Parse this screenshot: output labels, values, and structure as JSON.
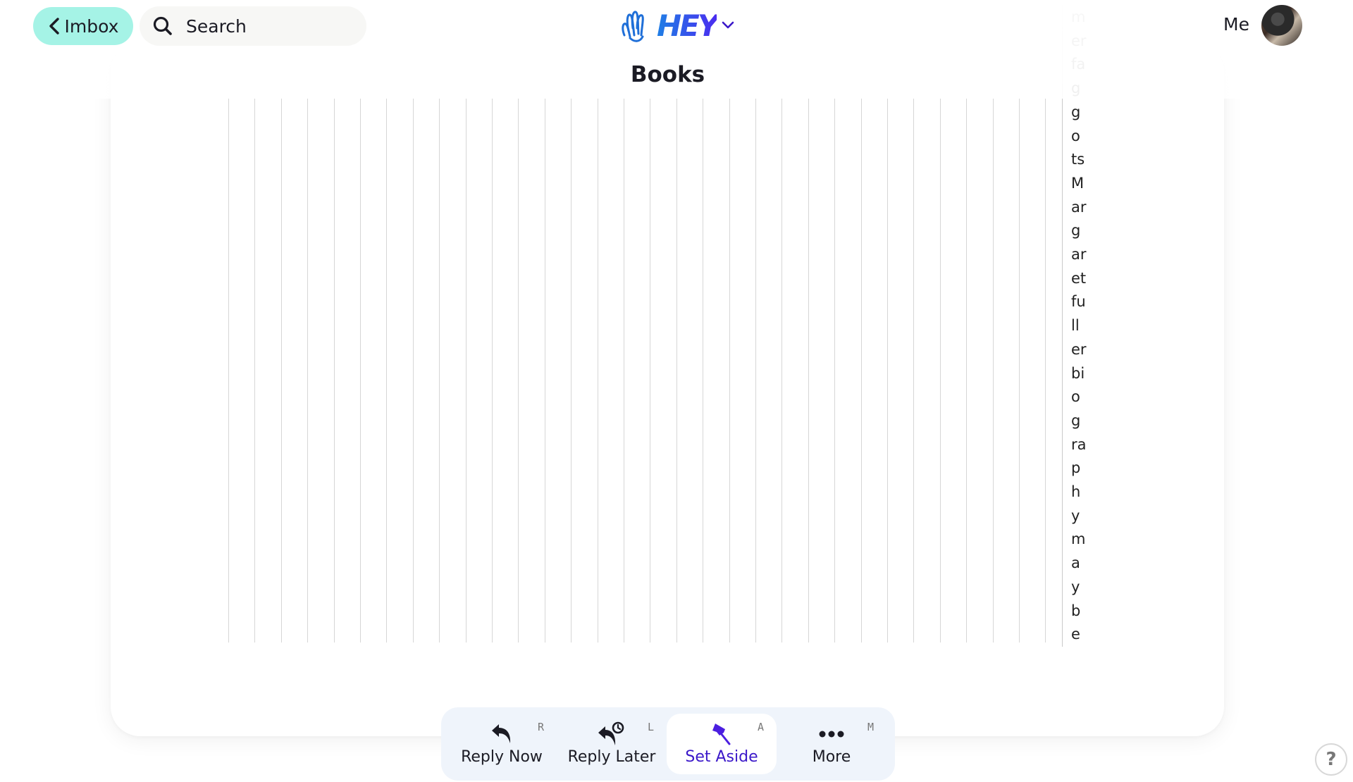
{
  "header": {
    "back_button_label": "Imbox",
    "search_label": "Search",
    "logo_text": "HEY",
    "page_title": "Books",
    "user_label": "Me"
  },
  "content": {
    "vertical_text_tokens": [
      "m",
      "er",
      "fa",
      "g",
      "g",
      "o",
      "ts",
      "M",
      "ar",
      "g",
      "ar",
      "et",
      "fu",
      "ll",
      "er",
      "bi",
      "o",
      "g",
      "ra",
      "p",
      "h",
      "y",
      "m",
      "a",
      "y",
      "b",
      "e"
    ],
    "faded_token_count": 4,
    "rule_count": 32
  },
  "toolbar": {
    "buttons": [
      {
        "label": "Reply Now",
        "shortcut": "R",
        "icon": "reply-icon",
        "active": false
      },
      {
        "label": "Reply Later",
        "shortcut": "L",
        "icon": "reply-later-clock-icon",
        "active": false
      },
      {
        "label": "Set Aside",
        "shortcut": "A",
        "icon": "pin-icon",
        "active": true
      },
      {
        "label": "More",
        "shortcut": "M",
        "icon": "more-dots-icon",
        "active": false
      }
    ]
  },
  "help": {
    "label": "?"
  },
  "colors": {
    "accent": "#3b18c9",
    "imbox_button": "#a5f3e6",
    "toolbar_bg": "#eff4fb"
  }
}
